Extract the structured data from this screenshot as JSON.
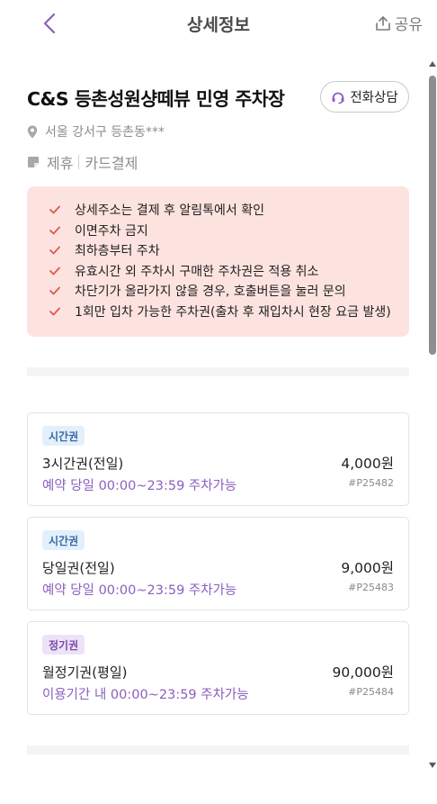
{
  "header": {
    "title": "상세정보",
    "share_label": "공유"
  },
  "place": {
    "name": "C&S 등촌성원샹떼뷰 민영 주차장",
    "call_label": "전화상담",
    "address": "서울 강서구 등촌동***",
    "tags": [
      "제휴",
      "카드결제"
    ]
  },
  "notices": [
    "상세주소는 결제 후 알림톡에서 확인",
    "이면주차 금지",
    "최하층부터 주차",
    "유효시간 외 주차시 구매한 주차권은 적용 취소",
    "차단기가 올라가지 않을 경우, 호출버튼을 눌러 문의",
    "1회만 입차 가능한 주차권(출차 후 재입차시 현장 요금 발생)"
  ],
  "tickets": [
    {
      "badge": "시간권",
      "name": "3시간권(전일)",
      "price": "4,000원",
      "time": "예약 당일 00:00~23:59 주차가능",
      "code": "#P25482"
    },
    {
      "badge": "시간권",
      "name": "당일권(전일)",
      "price": "9,000원",
      "time": "예약 당일 00:00~23:59 주차가능",
      "code": "#P25483"
    },
    {
      "badge": "정기권",
      "name": "월정기권(평일)",
      "price": "90,000원",
      "time": "이용기간 내 00:00~23:59 주차가능",
      "code": "#P25484"
    }
  ],
  "colors": {
    "accent": "#8b5fbf",
    "notice_bg": "#fde3df",
    "check": "#e0584c"
  }
}
